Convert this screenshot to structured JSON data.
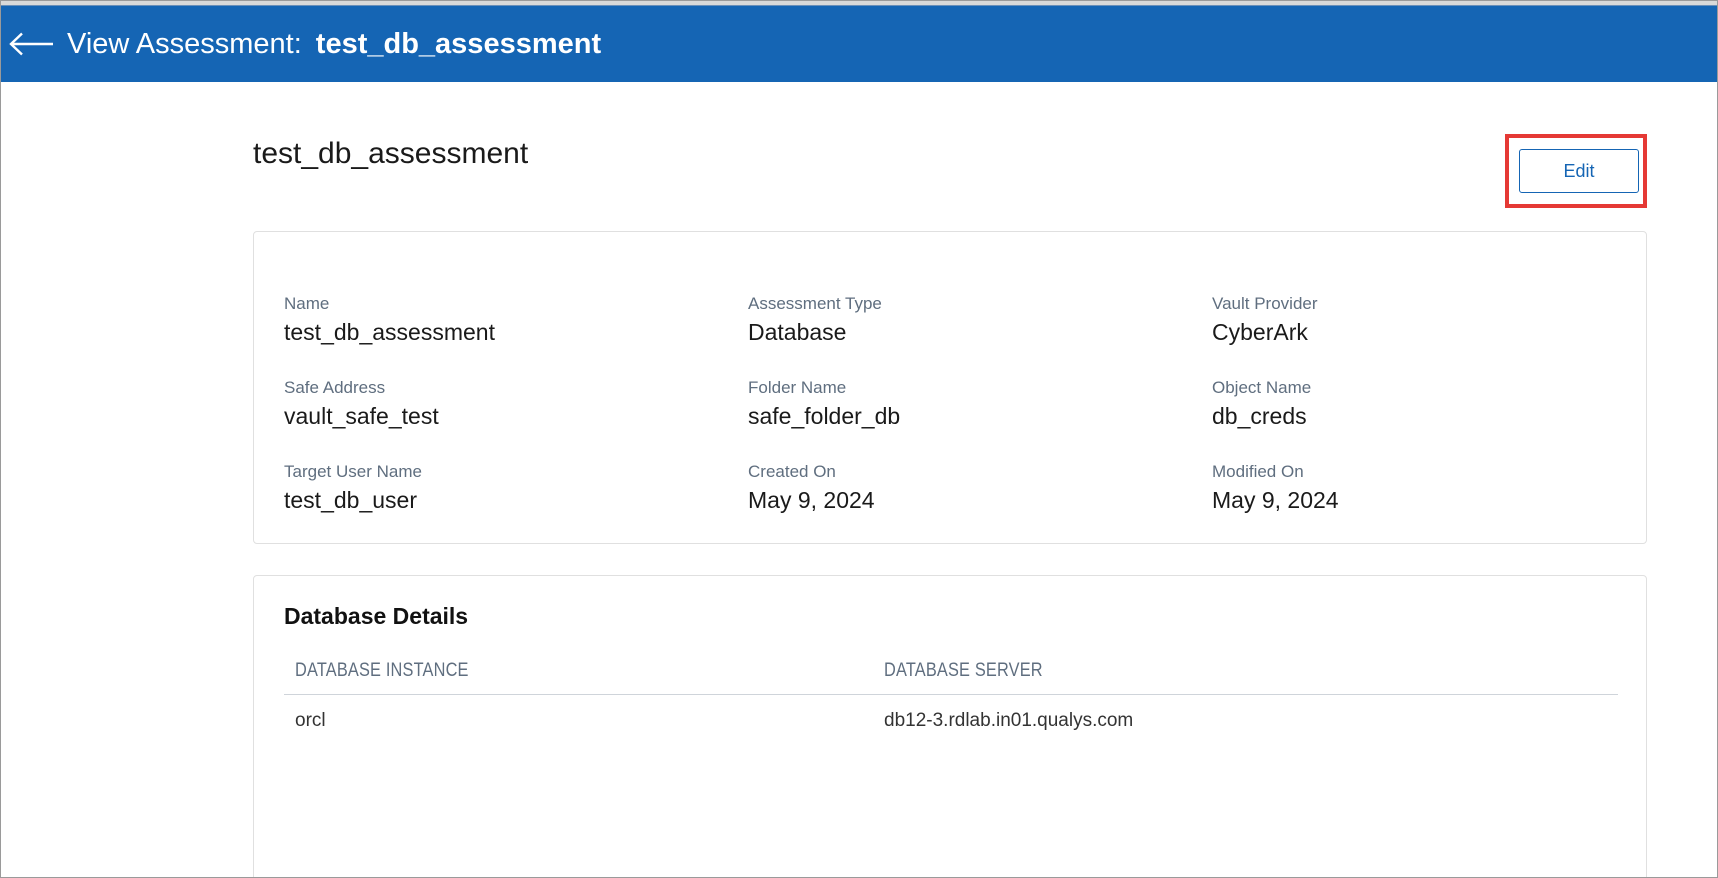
{
  "header": {
    "title_prefix": "View Assessment:",
    "title_name": "test_db_assessment",
    "bg_color": "#1565b4"
  },
  "page": {
    "heading": "test_db_assessment",
    "edit_label": "Edit",
    "highlight_color": "#e53935"
  },
  "details": {
    "name_label": "Name",
    "name_value": "test_db_assessment",
    "type_label": "Assessment Type",
    "type_value": "Database",
    "vault_label": "Vault Provider",
    "vault_value": "CyberArk",
    "safe_label": "Safe Address",
    "safe_value": "vault_safe_test",
    "folder_label": "Folder Name",
    "folder_value": "safe_folder_db",
    "object_label": "Object Name",
    "object_value": "db_creds",
    "target_label": "Target User Name",
    "target_value": "test_db_user",
    "created_label": "Created On",
    "created_value": "May 9, 2024",
    "modified_label": "Modified On",
    "modified_value": "May 9, 2024"
  },
  "database": {
    "title": "Database Details",
    "columns": [
      "DATABASE INSTANCE",
      "DATABASE SERVER"
    ],
    "rows": [
      [
        "orcl",
        "db12-3.rdlab.in01.qualys.com"
      ]
    ]
  },
  "icons": {
    "back": "arrow-left-icon"
  }
}
